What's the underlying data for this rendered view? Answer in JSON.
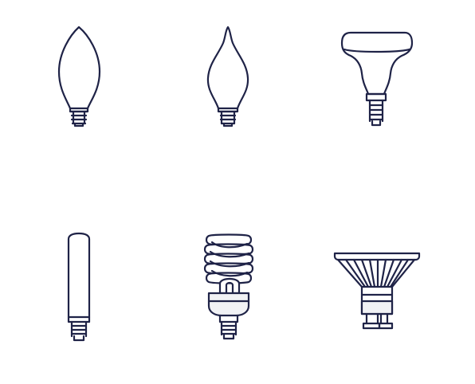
{
  "page": {
    "background": "#ffffff",
    "line_color": "#1f2347",
    "fill_light": "#f1f2f5"
  },
  "icons": [
    {
      "name": "candle-bulb-icon"
    },
    {
      "name": "flame-tip-bulb-icon"
    },
    {
      "name": "reflector-bulb-icon"
    },
    {
      "name": "tubular-bulb-icon"
    },
    {
      "name": "spiral-cfl-bulb-icon"
    },
    {
      "name": "gu10-spot-bulb-icon"
    }
  ]
}
